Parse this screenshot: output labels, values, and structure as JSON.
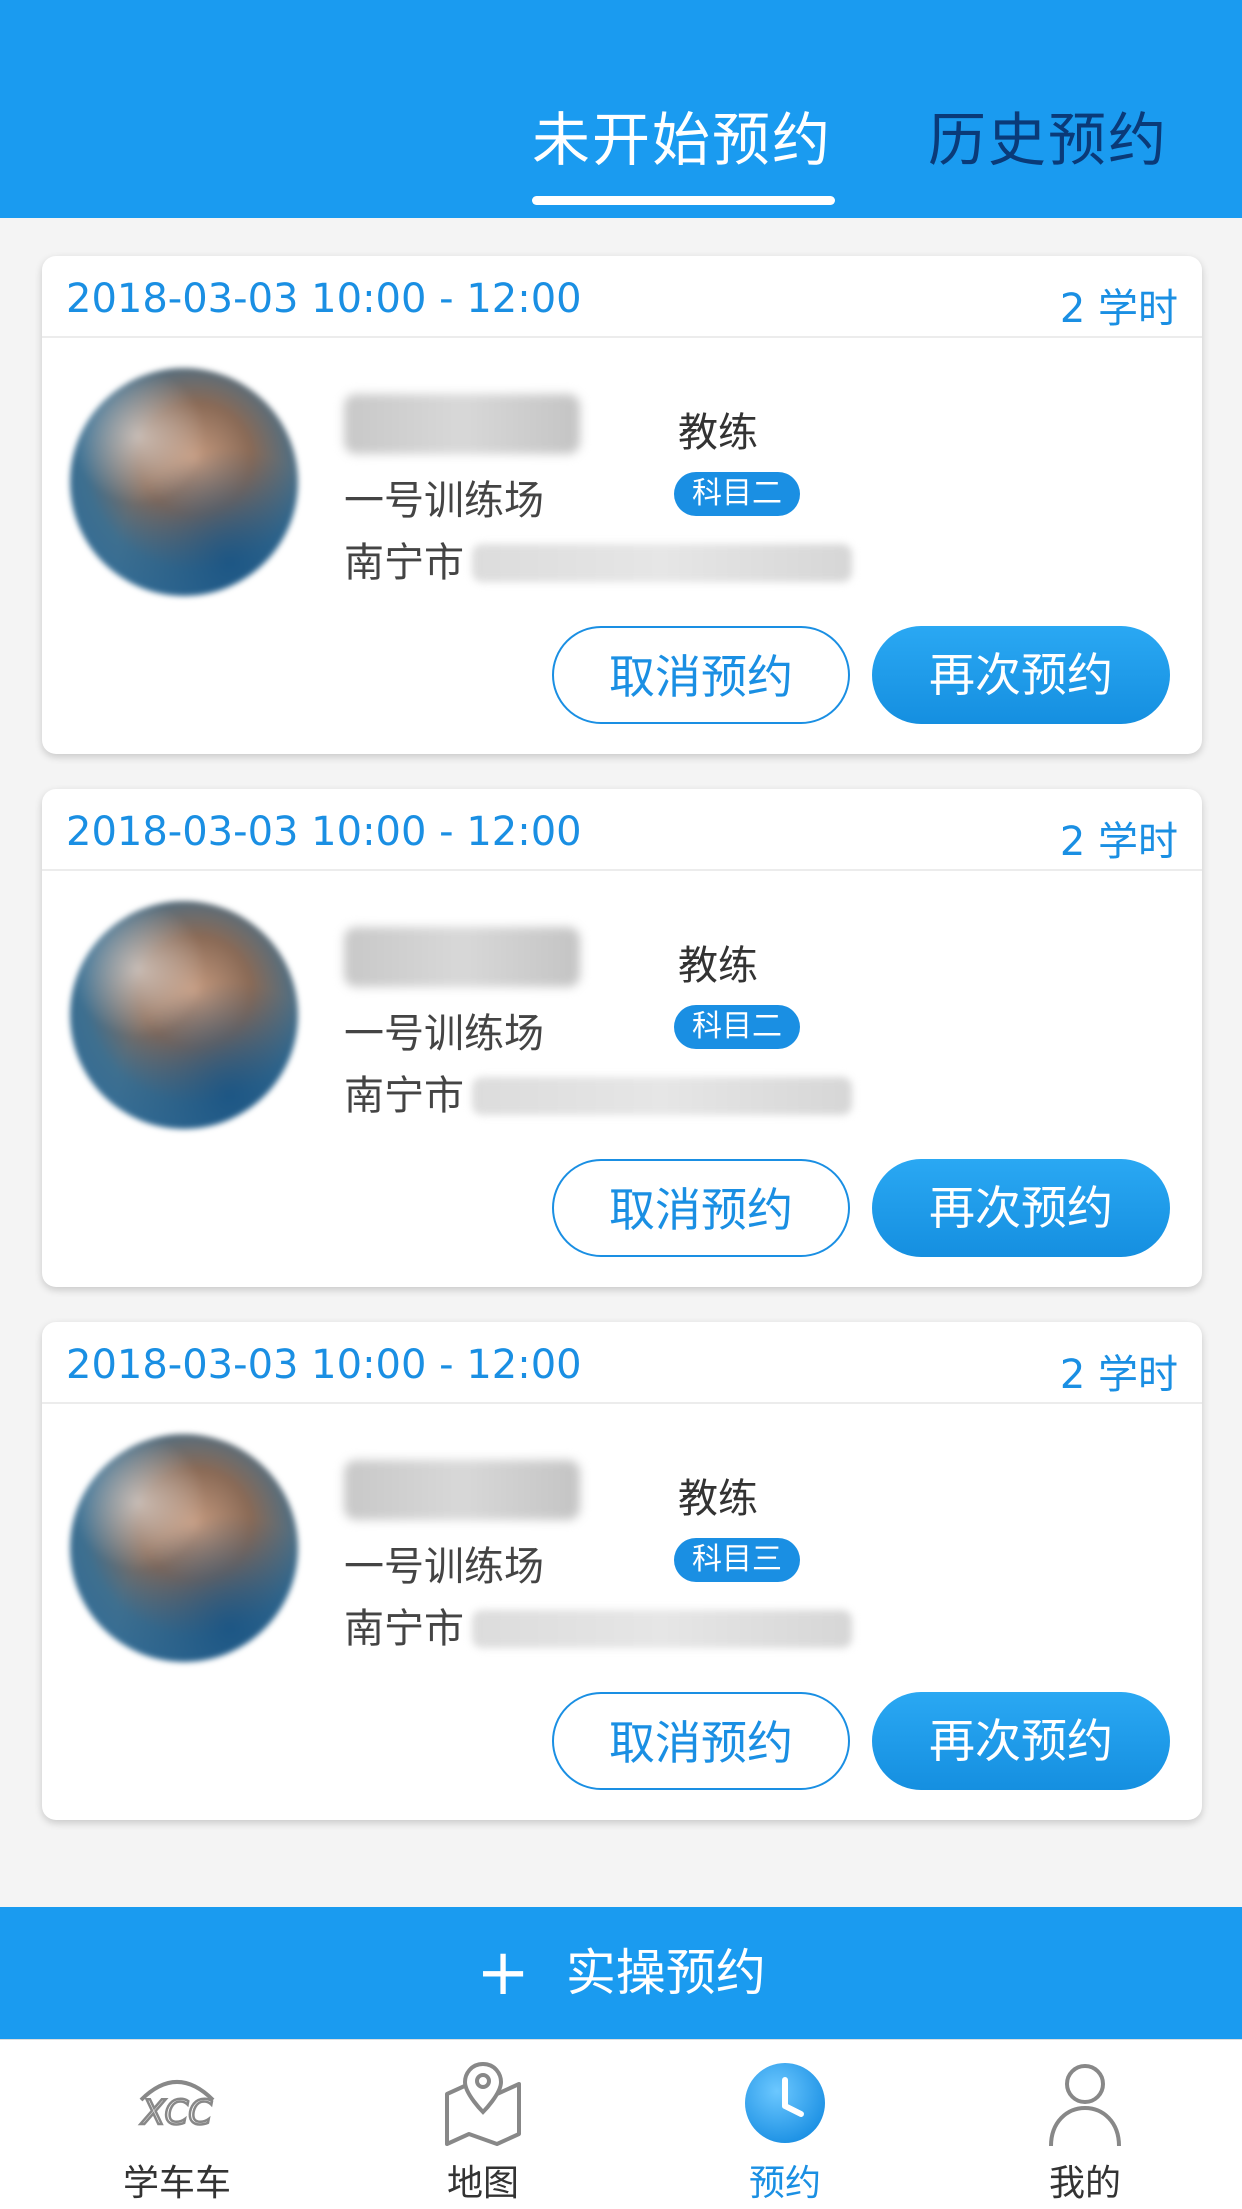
{
  "header": {
    "tabs": [
      {
        "label": "未开始预约",
        "active": true
      },
      {
        "label": "历史预约",
        "active": false
      }
    ]
  },
  "appointments": [
    {
      "time": "2018-03-03  10:00 - 12:00",
      "hours": "2  学时",
      "role": "教练",
      "venue": "一号训练场",
      "subject": "科目二",
      "city": "南宁市",
      "cancel_label": "取消预约",
      "rebook_label": "再次预约"
    },
    {
      "time": "2018-03-03  10:00 - 12:00",
      "hours": "2  学时",
      "role": "教练",
      "venue": "一号训练场",
      "subject": "科目二",
      "city": "南宁市",
      "cancel_label": "取消预约",
      "rebook_label": "再次预约"
    },
    {
      "time": "2018-03-03  10:00 - 12:00",
      "hours": "2  学时",
      "role": "教练",
      "venue": "一号训练场",
      "subject": "科目三",
      "city": "南宁市",
      "cancel_label": "取消预约",
      "rebook_label": "再次预约"
    }
  ],
  "action_bar": {
    "plus": "+",
    "label": "实操预约"
  },
  "tabbar": {
    "items": [
      {
        "label": "学车车",
        "icon": "xcc-logo-icon",
        "active": false
      },
      {
        "label": "地图",
        "icon": "map-pin-icon",
        "active": false
      },
      {
        "label": "预约",
        "icon": "clock-icon",
        "active": true
      },
      {
        "label": "我的",
        "icon": "user-icon",
        "active": false
      }
    ]
  },
  "colors": {
    "primary": "#1a9bf0",
    "accent": "#1a8fe3",
    "inactive_tab": "#0a3a78"
  }
}
